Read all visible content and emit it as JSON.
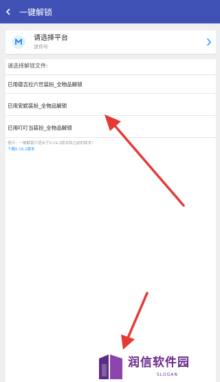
{
  "appbar": {
    "back_icon": "back-arrow-icon",
    "title": "一键解锁"
  },
  "platform": {
    "icon": "app-logo-icon",
    "title": "请选择平台",
    "subtitle": "迷你号",
    "chevron_icon": "chevron-right-icon"
  },
  "files": {
    "section_label": "请选择解锁文件:",
    "items": [
      {
        "label": "已用德吉拉六世装扮_全物品解锁"
      },
      {
        "label": "已用安妮装扮_全物品解锁"
      },
      {
        "label": "已用叮叮当装扮_全物品解锁"
      }
    ]
  },
  "hint": "提示：一键解锁只适合于0.19.2版本和之前的版本！",
  "download_link": "下载0.19.2版本",
  "watermark": {
    "brand": "润信软件园",
    "slogan": "SLOGAN"
  },
  "colors": {
    "appbar": "#3f51b5",
    "link": "#2196f3",
    "annotation_arrow": "#e53935",
    "watermark": "#6a2a8c"
  }
}
